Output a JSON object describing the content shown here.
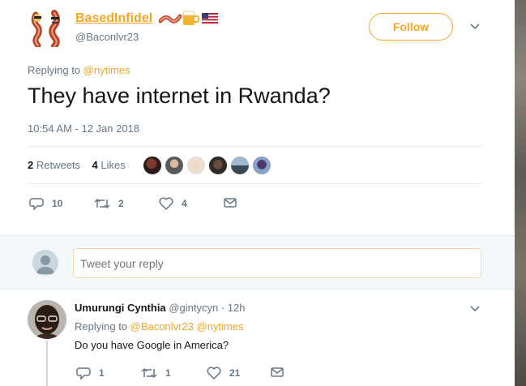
{
  "tweet": {
    "display_name": "BasedInfidel",
    "handle": "@Baconlvr23",
    "follow_label": "Follow",
    "replying_prefix": "Replying to",
    "replying_mention": "@nytimes",
    "text": "They have internet in Rwanda?",
    "timestamp": "10:54 AM - 12 Jan 2018",
    "retweets_count": "2",
    "retweets_label": "Retweets",
    "likes_count": "4",
    "likes_label": "Likes",
    "actions": {
      "reply_count": "10",
      "retweet_count": "2",
      "like_count": "4"
    }
  },
  "compose": {
    "placeholder": "Tweet your reply"
  },
  "reply": {
    "name": "Umurungi Cynthia",
    "handle": "@gintycyn",
    "separator": "·",
    "time": "12h",
    "replying_prefix": "Replying to",
    "mention_1": "@Baconlvr23",
    "mention_2": "@nytimes",
    "text": "Do you have Google in America?",
    "actions": {
      "reply_count": "1",
      "retweet_count": "1",
      "like_count": "21"
    }
  },
  "colors": {
    "accent": "#f5a623",
    "secondary_text": "#657786",
    "divider": "#e6ecf0"
  }
}
